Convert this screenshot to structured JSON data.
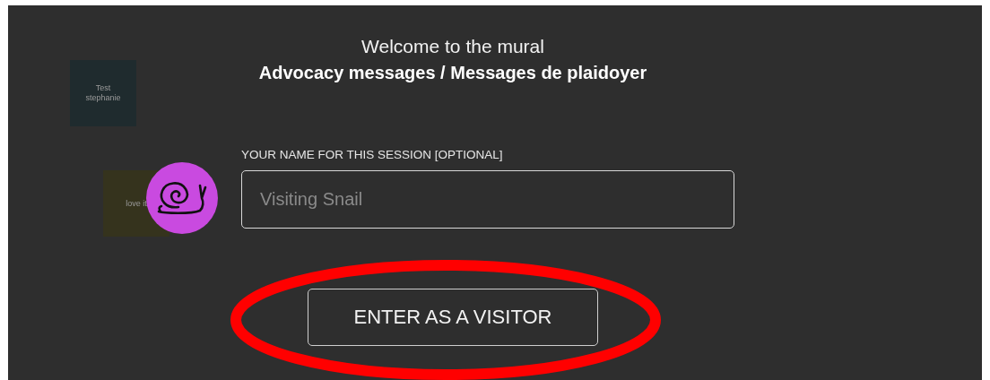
{
  "background_notes": [
    {
      "text": "Test stephanie",
      "color": "#1f2b2e"
    },
    {
      "text": "love it",
      "color": "#35331d"
    }
  ],
  "welcome": {
    "title": "Welcome to the mural",
    "subtitle": "Advocacy messages / Messages de plaidoyer"
  },
  "name_field": {
    "label": "YOUR NAME FOR THIS SESSION [OPTIONAL]",
    "placeholder": "Visiting Snail"
  },
  "enter_button": {
    "label": "ENTER AS A VISITOR"
  },
  "highlight": {
    "kind": "ellipse",
    "color": "#ff0000"
  }
}
